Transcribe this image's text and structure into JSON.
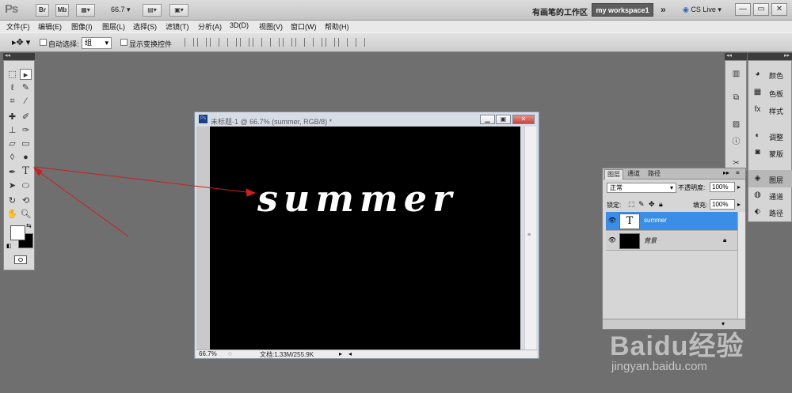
{
  "app": {
    "logo": "Ps",
    "br_btn": "Br",
    "mb_btn": "Mb",
    "zoom": "66.7",
    "workspace_label": "有画笔的工作区",
    "workspace_button": "my workspace1",
    "cs_live": "CS Live",
    "window_controls": [
      "—",
      "▭",
      "✕"
    ]
  },
  "menu": [
    "文件(F)",
    "编辑(E)",
    "图像(I)",
    "图层(L)",
    "选择(S)",
    "滤镜(T)",
    "分析(A)",
    "3D(D)",
    "视图(V)",
    "窗口(W)",
    "帮助(H)"
  ],
  "options": {
    "auto_select_label": "自动选择:",
    "auto_select_value": "组",
    "show_transform_label": "显示变换控件"
  },
  "document": {
    "title": "未标题-1 @ 66.7% (summer, RGB/8) *",
    "canvas_text": "summer",
    "zoom_status": "66.7%",
    "info": "文档:1.33M/255.9K"
  },
  "dock2": {
    "items": [
      "颜色",
      "色板",
      "样式",
      "调整",
      "蒙版",
      "图层",
      "通道",
      "路径"
    ]
  },
  "layers_panel": {
    "tabs": [
      "图层",
      "通道",
      "路径"
    ],
    "blend_mode": "正常",
    "opacity_label": "不透明度:",
    "opacity": "100%",
    "lock_label": "锁定:",
    "fill_label": "填充:",
    "fill": "100%",
    "layers": [
      {
        "name": "summer",
        "thumb": "T"
      },
      {
        "name": "背景",
        "thumb": ""
      }
    ]
  },
  "watermark": {
    "logo": "Baidu经验",
    "url": "jingyan.baidu.com"
  },
  "colors": {
    "accent_selection": "#3a8ee8",
    "annotation_arrow": "#cc1f1f",
    "canvas": "#000000"
  }
}
